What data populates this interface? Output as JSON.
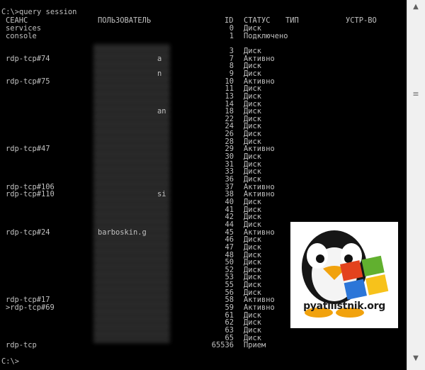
{
  "console": {
    "command_line": "C:\\>query session",
    "headers": {
      "session": "СЕАНС",
      "user": "ПОЛЬЗОВАТЕЛЬ",
      "id": "ID",
      "status": "СТАТУС",
      "type": "ТИП",
      "device": "УСТР-ВО"
    },
    "rows": [
      {
        "session": "services",
        "user": "",
        "id": "0",
        "status": "Диск"
      },
      {
        "session": "console",
        "user": "",
        "id": "1",
        "status": "Подключено"
      },
      {
        "session": "",
        "user": "",
        "id": "",
        "status": ""
      },
      {
        "session": "",
        "user": "",
        "id": "3",
        "status": "Диск"
      },
      {
        "session": "rdp-tcp#74",
        "user": "a",
        "id": "7",
        "status": "Активно"
      },
      {
        "session": "",
        "user": "",
        "id": "8",
        "status": "Диск"
      },
      {
        "session": "",
        "user": "n",
        "id": "9",
        "status": "Диск"
      },
      {
        "session": "rdp-tcp#75",
        "user": "",
        "id": "10",
        "status": "Активно"
      },
      {
        "session": "",
        "user": "",
        "id": "11",
        "status": "Диск"
      },
      {
        "session": "",
        "user": "",
        "id": "13",
        "status": "Диск"
      },
      {
        "session": "",
        "user": "",
        "id": "14",
        "status": "Диск"
      },
      {
        "session": "",
        "user": "an",
        "id": "18",
        "status": "Диск"
      },
      {
        "session": "",
        "user": "",
        "id": "22",
        "status": "Диск"
      },
      {
        "session": "",
        "user": "",
        "id": "24",
        "status": "Диск"
      },
      {
        "session": "",
        "user": "",
        "id": "26",
        "status": "Диск"
      },
      {
        "session": "",
        "user": "",
        "id": "28",
        "status": "Диск"
      },
      {
        "session": "rdp-tcp#47",
        "user": "",
        "id": "29",
        "status": "Активно"
      },
      {
        "session": "",
        "user": "",
        "id": "30",
        "status": "Диск"
      },
      {
        "session": "",
        "user": "",
        "id": "31",
        "status": "Диск"
      },
      {
        "session": "",
        "user": "",
        "id": "33",
        "status": "Диск"
      },
      {
        "session": "",
        "user": "",
        "id": "36",
        "status": "Диск"
      },
      {
        "session": "rdp-tcp#106",
        "user": "",
        "id": "37",
        "status": "Активно"
      },
      {
        "session": "rdp-tcp#110",
        "user": "si",
        "id": "38",
        "status": "Активно"
      },
      {
        "session": "",
        "user": "",
        "id": "40",
        "status": "Диск"
      },
      {
        "session": "",
        "user": "",
        "id": "41",
        "status": "Диск"
      },
      {
        "session": "",
        "user": "",
        "id": "42",
        "status": "Диск"
      },
      {
        "session": "",
        "user": "",
        "id": "44",
        "status": "Диск"
      },
      {
        "session": "rdp-tcp#24",
        "user": "barboskin.g",
        "id": "45",
        "status": "Активно"
      },
      {
        "session": "",
        "user": "",
        "id": "46",
        "status": "Диск"
      },
      {
        "session": "",
        "user": "",
        "id": "47",
        "status": "Диск"
      },
      {
        "session": "",
        "user": "",
        "id": "48",
        "status": "Диск"
      },
      {
        "session": "",
        "user": "",
        "id": "50",
        "status": "Диск"
      },
      {
        "session": "",
        "user": "",
        "id": "52",
        "status": "Диск"
      },
      {
        "session": "",
        "user": "",
        "id": "53",
        "status": "Диск"
      },
      {
        "session": "",
        "user": "",
        "id": "55",
        "status": "Диск"
      },
      {
        "session": "",
        "user": "",
        "id": "56",
        "status": "Диск"
      },
      {
        "session": "rdp-tcp#17",
        "user": "",
        "id": "58",
        "status": "Активно"
      },
      {
        "session": ">rdp-tcp#69",
        "user": "",
        "id": "59",
        "status": "Активно"
      },
      {
        "session": "",
        "user": "",
        "id": "61",
        "status": "Диск"
      },
      {
        "session": "",
        "user": "",
        "id": "62",
        "status": "Диск"
      },
      {
        "session": "",
        "user": "",
        "id": "63",
        "status": "Диск"
      },
      {
        "session": "",
        "user": "",
        "id": "65",
        "status": "Диск"
      },
      {
        "session": "rdp-tcp",
        "user": "",
        "id": "65536",
        "status": "Прием"
      }
    ],
    "prompt": "C:\\>"
  },
  "scrollbar": {
    "up_arrow": "▲",
    "down_arrow": "▼",
    "grip": "≡"
  },
  "logo": {
    "text": "pyatilistnik.org"
  },
  "colors": {
    "console_bg": "#000000",
    "console_text": "#c0c0c0"
  }
}
